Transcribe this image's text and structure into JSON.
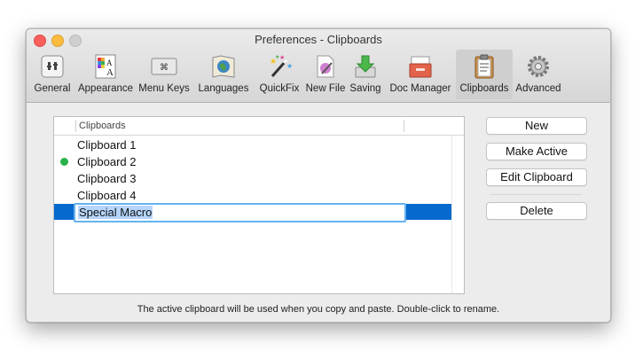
{
  "window": {
    "title": "Preferences - Clipboards"
  },
  "toolbar": {
    "items": [
      {
        "label": "General",
        "icon": "general-icon"
      },
      {
        "label": "Appearance",
        "icon": "appearance-icon"
      },
      {
        "label": "Menu Keys",
        "icon": "menu-keys-icon"
      },
      {
        "label": "Languages",
        "icon": "languages-icon"
      },
      {
        "label": "QuickFix",
        "icon": "quickfix-icon"
      },
      {
        "label": "New File",
        "icon": "new-file-icon"
      },
      {
        "label": "Saving",
        "icon": "saving-icon"
      },
      {
        "label": "Doc Manager",
        "icon": "doc-manager-icon"
      },
      {
        "label": "Clipboards",
        "icon": "clipboards-icon",
        "selected": true
      },
      {
        "label": "Advanced",
        "icon": "advanced-icon"
      }
    ]
  },
  "clipboards": {
    "column_header": "Clipboards",
    "rows": [
      {
        "name": "Clipboard 1",
        "active": false
      },
      {
        "name": "Clipboard 2",
        "active": true
      },
      {
        "name": "Clipboard 3",
        "active": false
      },
      {
        "name": "Clipboard 4",
        "active": false
      },
      {
        "name": "Special Macro",
        "active": false,
        "editing": true
      }
    ],
    "active_color": "#29b24a",
    "selection_color": "#0669cd"
  },
  "buttons": {
    "new": "New",
    "make_active": "Make Active",
    "edit_clipboard": "Edit Clipboard",
    "delete": "Delete"
  },
  "footer": {
    "text": "The active clipboard will be used when you copy and paste.  Double-click to rename."
  }
}
